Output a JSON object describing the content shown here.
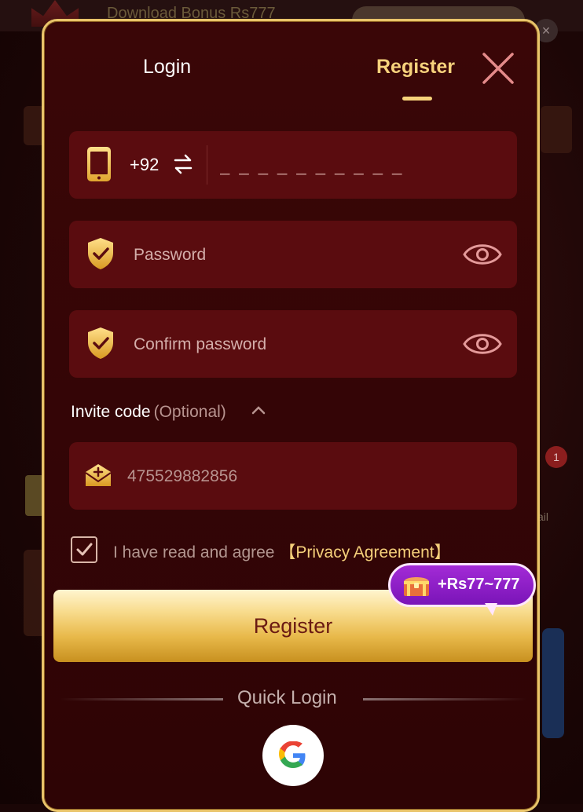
{
  "background": {
    "banner_text": "Download Bonus Rs777",
    "badge_count": "1",
    "side_label": "ail",
    "close_glyph": "×"
  },
  "tabs": {
    "login": "Login",
    "register": "Register",
    "active": "Register"
  },
  "phone": {
    "icon": "phone-icon",
    "country_code": "+92",
    "swap_icon": "swap-arrows-icon",
    "placeholder": "_ _ _ _ _ _ _ _ _ _"
  },
  "password": {
    "icon": "shield-check-icon",
    "placeholder": "Password",
    "toggle_icon": "eye-icon"
  },
  "confirm_password": {
    "icon": "shield-check-icon",
    "placeholder": "Confirm password",
    "toggle_icon": "eye-icon"
  },
  "invite": {
    "label": "Invite code",
    "optional": "(Optional)",
    "icon": "gift-envelope-icon",
    "value": "475529882856"
  },
  "agreement": {
    "checked": true,
    "text": "I have read and agree",
    "link": "【Privacy Agreement】"
  },
  "register_button": {
    "label": "Register"
  },
  "bonus": {
    "text": "+Rs77~777",
    "icon": "treasure-chest-icon"
  },
  "quick_login": {
    "title": "Quick Login",
    "providers": [
      "google"
    ]
  },
  "colors": {
    "accent_gold": "#f7d27c",
    "panel_bg": "#3a0607",
    "field_bg": "#5a0c0f",
    "bonus_purple": "#8a1fc4"
  }
}
